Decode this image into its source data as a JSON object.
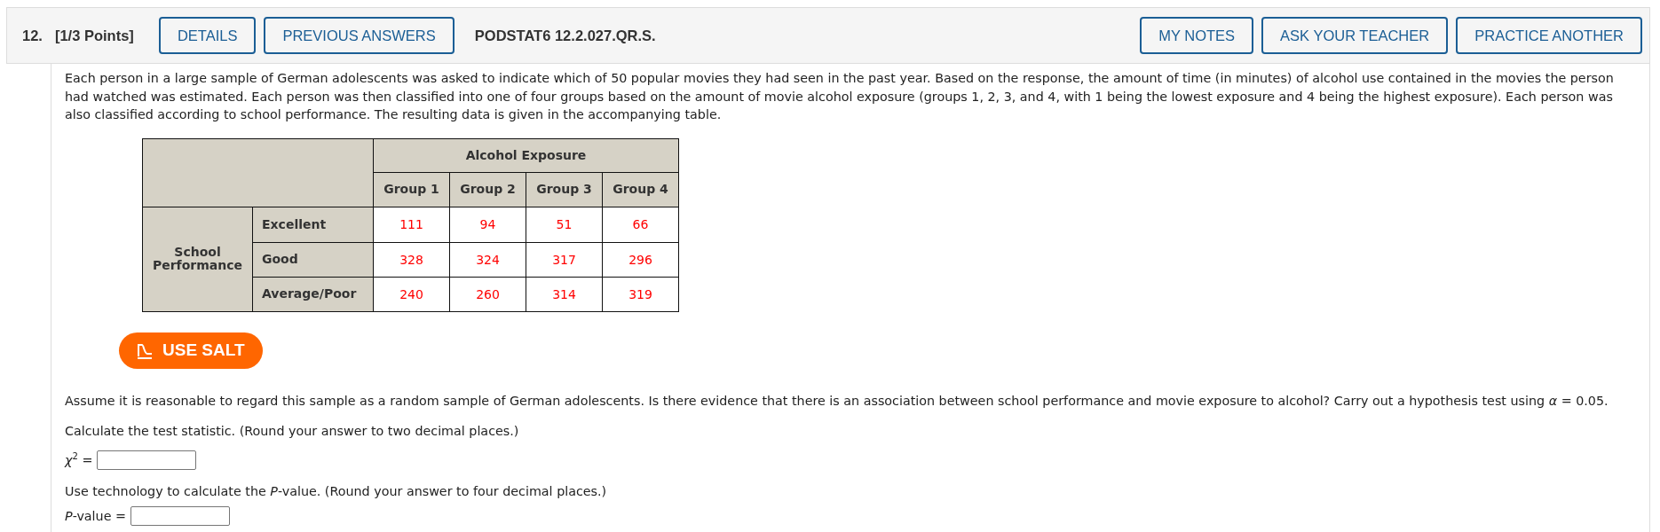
{
  "header": {
    "number": "12.",
    "points": "[1/3 Points]",
    "left_buttons": [
      "DETAILS",
      "PREVIOUS ANSWERS"
    ],
    "code": "PODSTAT6 12.2.027.QR.S.",
    "right_buttons": [
      "MY NOTES",
      "ASK YOUR TEACHER",
      "PRACTICE ANOTHER"
    ]
  },
  "intro": "Each person in a large sample of German adolescents was asked to indicate which of 50 popular movies they had seen in the past year. Based on the response, the amount of time (in minutes) of alcohol use contained in the movies the person had watched was estimated. Each person was then classified into one of four groups based on the amount of movie alcohol exposure (groups 1, 2, 3, and 4, with 1 being the lowest exposure and 4 being the highest exposure). Each person was also classified according to school performance. The resulting data is given in the accompanying table.",
  "table": {
    "column_group": "Alcohol Exposure",
    "columns": [
      "Group 1",
      "Group 2",
      "Group 3",
      "Group 4"
    ],
    "row_group": "School Performance",
    "rows": [
      {
        "label": "Excellent",
        "values": [
          "111",
          "94",
          "51",
          "66"
        ]
      },
      {
        "label": "Good",
        "values": [
          "328",
          "324",
          "317",
          "296"
        ]
      },
      {
        "label": "Average/Poor",
        "values": [
          "240",
          "260",
          "314",
          "319"
        ]
      }
    ]
  },
  "salt_button": "USE SALT",
  "instructions": "Assume it is reasonable to regard this sample as a random sample of German adolescents. Is there evidence that there is an association between school performance and movie exposure to alcohol? Carry out a hypothesis test using *α* = 0.05.",
  "parts": [
    {
      "prompt": "Calculate the test statistic. (Round your answer to two decimal places.)",
      "label": "*χ*$^{2}$ ="
    },
    {
      "prompt": "Use technology to calculate the *P*-value. (Round your answer to four decimal places.)",
      "label": "*P*-value ="
    }
  ]
}
